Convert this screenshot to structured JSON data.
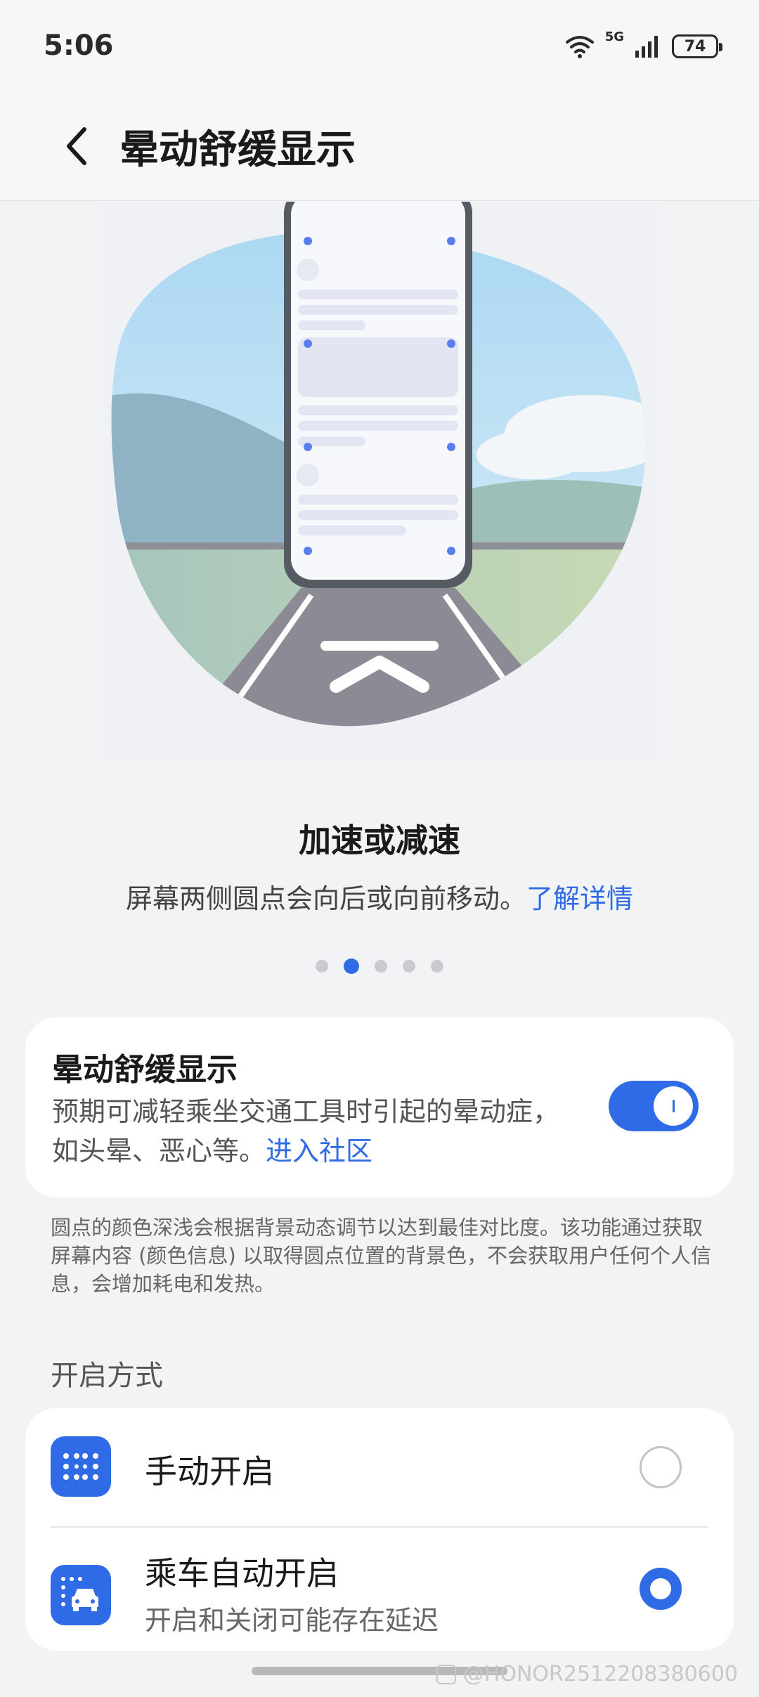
{
  "status_bar": {
    "time": "5:06",
    "network": "5G",
    "battery": "74"
  },
  "header": {
    "title": "晕动舒缓显示"
  },
  "hero": {
    "title": "加速或减速",
    "description": "屏幕两侧圆点会向后或向前移动。",
    "link": "了解详情",
    "page_index": 2,
    "page_count": 5
  },
  "toggle_card": {
    "title": "晕动舒缓显示",
    "description": "预期可减轻乘坐交通工具时引起的晕动症，如头晕、恶心等。",
    "link": "进入社区",
    "enabled": true
  },
  "note": "圆点的颜色深浅会根据背景动态调节以达到最佳对比度。该功能通过获取屏幕内容 (颜色信息) 以取得圆点位置的背景色，不会获取用户任何个人信息，会增加耗电和发热。",
  "methods": {
    "section_label": "开启方式",
    "options": [
      {
        "label": "手动开启",
        "subtitle": "",
        "icon": "dots-grid-icon",
        "selected": false
      },
      {
        "label": "乘车自动开启",
        "subtitle": "开启和关闭可能存在延迟",
        "icon": "car-icon",
        "selected": true
      }
    ]
  },
  "watermark": "@HONOR2512208380600",
  "colors": {
    "accent": "#2f6be6",
    "background": "#f1f3f5",
    "card": "#ffffff"
  }
}
